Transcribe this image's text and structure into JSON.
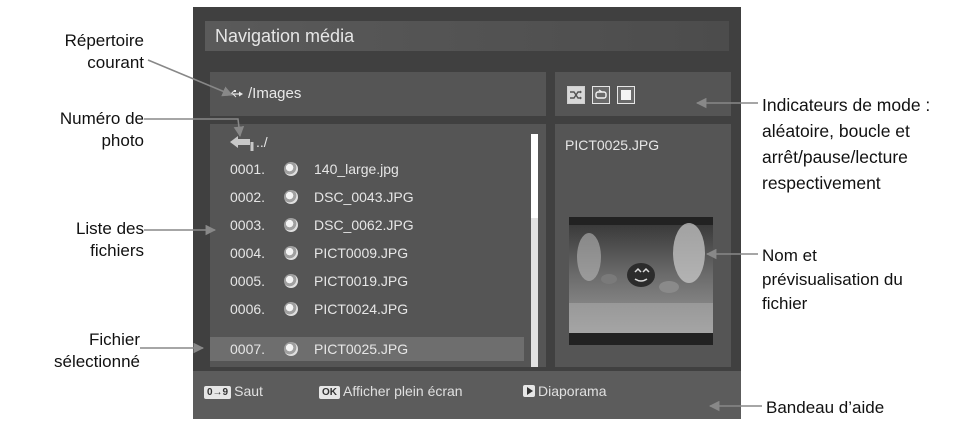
{
  "screen": {
    "title": "Navigation média",
    "path": "/Images",
    "up_dir": "../",
    "files": [
      {
        "num": "0001.",
        "name": "140_large.jpg"
      },
      {
        "num": "0002.",
        "name": "DSC_0043.JPG"
      },
      {
        "num": "0003.",
        "name": "DSC_0062.JPG"
      },
      {
        "num": "0004.",
        "name": "PICT0009.JPG"
      },
      {
        "num": "0005.",
        "name": "PICT0019.JPG"
      },
      {
        "num": "0006.",
        "name": "PICT0024.JPG"
      },
      {
        "num": "0007.",
        "name": "PICT0025.JPG"
      }
    ],
    "selected_index": 6,
    "preview_filename": "PICT0025.JPG",
    "help": {
      "jump_key": "0→9",
      "jump_label": "Saut",
      "ok_key": "OK",
      "ok_label": "Afficher plein écran",
      "slideshow_label": "Diaporama"
    }
  },
  "annotations": {
    "current_dir": "Répertoire courant",
    "photo_number": "Numéro de photo",
    "file_list": "Liste des fichiers",
    "selected_file": "Fichier sélectionné",
    "mode_indicators": "Indicateurs de mode : aléatoire, boucle et arrêt/pause/lecture respectivement",
    "name_preview": "Nom et prévisualisation du fichier",
    "help_bar": "Bandeau d’aide"
  },
  "colors": {
    "screen_bg": "#404040",
    "panel_bg": "#555555",
    "selected_row": "#6e6e6e",
    "text": "#e6e6e6"
  }
}
